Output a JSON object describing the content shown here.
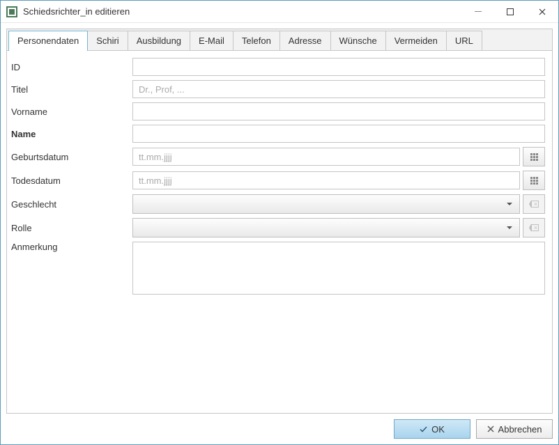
{
  "window": {
    "title": "Schiedsrichter_in editieren"
  },
  "tabs": [
    {
      "label": "Personendaten",
      "active": true
    },
    {
      "label": "Schiri"
    },
    {
      "label": "Ausbildung"
    },
    {
      "label": "E-Mail"
    },
    {
      "label": "Telefon"
    },
    {
      "label": "Adresse"
    },
    {
      "label": "Wünsche"
    },
    {
      "label": "Vermeiden"
    },
    {
      "label": "URL"
    }
  ],
  "labels": {
    "id": "ID",
    "titel": "Titel",
    "vorname": "Vorname",
    "name": "Name",
    "geburtsdatum": "Geburtsdatum",
    "todesdatum": "Todesdatum",
    "geschlecht": "Geschlecht",
    "rolle": "Rolle",
    "anmerkung": "Anmerkung"
  },
  "placeholders": {
    "titel": "Dr., Prof, ...",
    "geburtsdatum": "tt.mm.jjjj",
    "todesdatum": "tt.mm.jjjj"
  },
  "values": {
    "id": "",
    "titel": "",
    "vorname": "",
    "name": "",
    "geburtsdatum": "",
    "todesdatum": "",
    "geschlecht": "",
    "rolle": "",
    "anmerkung": ""
  },
  "buttons": {
    "ok": "OK",
    "cancel": "Abbrechen"
  },
  "icons": {
    "calendar": "calendar-icon",
    "clear": "clear-icon",
    "check": "check-icon",
    "cross": "cross-icon"
  }
}
